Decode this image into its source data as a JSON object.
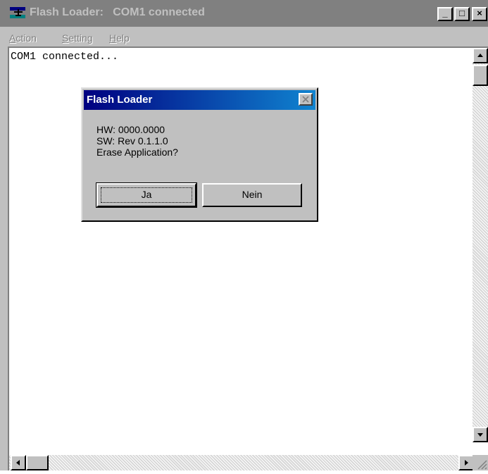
{
  "window": {
    "title": "Flash Loader:   COM1 connected",
    "minimize_glyph": "_",
    "maximize_glyph": "□",
    "close_glyph": "×"
  },
  "menu": {
    "items": [
      {
        "label": "Action",
        "mnemonic": "A"
      },
      {
        "label": "Setting",
        "mnemonic": "S"
      },
      {
        "label": "Help",
        "mnemonic": "H"
      }
    ]
  },
  "log": {
    "text": "COM1 connected..."
  },
  "dialog": {
    "title": "Flash Loader",
    "lines": [
      "HW: 0000.0000",
      "SW: Rev 0.1.1.0",
      "Erase Application?"
    ],
    "yes_label": "Ja",
    "no_label": "Nein"
  },
  "colors": {
    "title_inactive": "#808080",
    "dialog_title_start": "#000080",
    "dialog_title_end": "#1084d0"
  }
}
